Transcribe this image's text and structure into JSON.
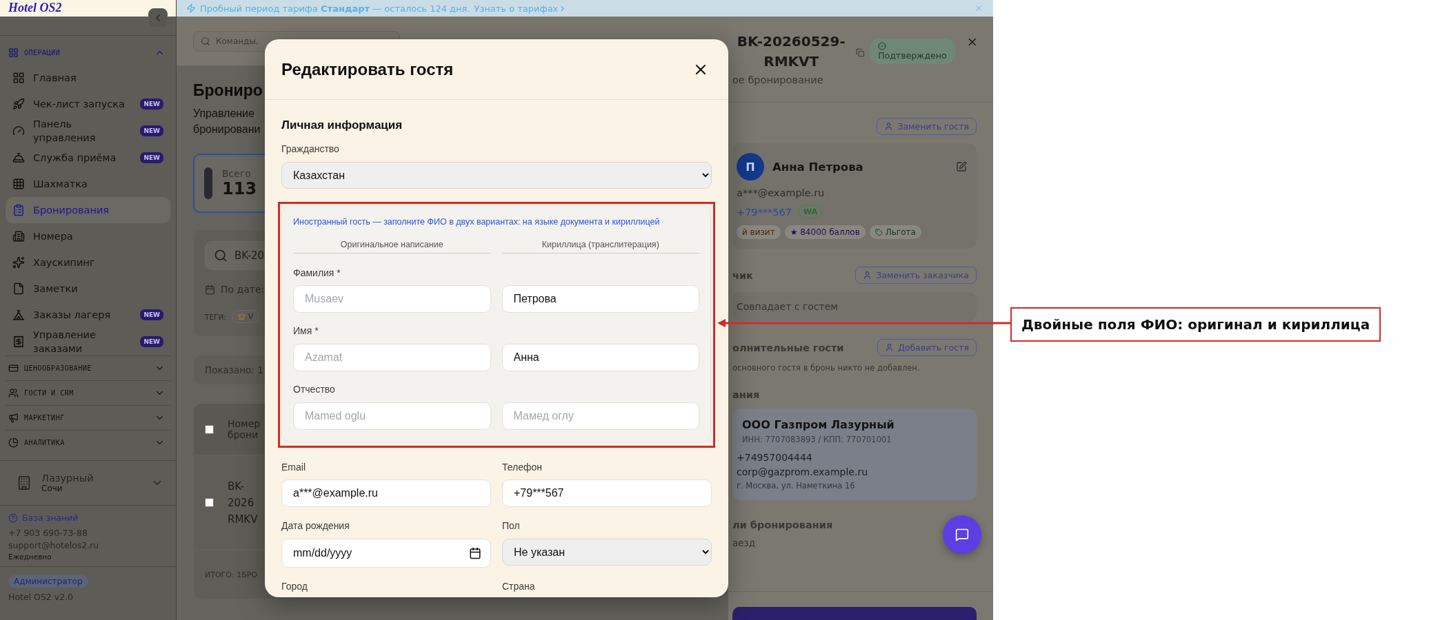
{
  "sidebar": {
    "logo": "Hotel OS2",
    "sections": [
      {
        "title": "ОПЕРАЦИИ",
        "expanded": true,
        "items": [
          {
            "label": "Главная",
            "selected": false
          },
          {
            "label": "Чек-лист запуска",
            "badge": "NEW",
            "selected": false
          },
          {
            "label": "Панель управления",
            "badge": "NEW",
            "selected": false
          },
          {
            "label": "Служба приёма",
            "badge": "NEW",
            "selected": false
          },
          {
            "label": "Шахматка",
            "selected": false
          },
          {
            "label": "Бронирования",
            "selected": true
          },
          {
            "label": "Номера",
            "selected": false
          },
          {
            "label": "Хаускипинг",
            "selected": false
          },
          {
            "label": "Заметки",
            "selected": false
          },
          {
            "label": "Заказы лагеря",
            "badge": "NEW",
            "selected": false
          },
          {
            "label": "Управление заказами",
            "badge": "NEW",
            "selected": false
          }
        ]
      },
      {
        "title": "ЦЕНООБРАЗОВАНИЕ",
        "expanded": false
      },
      {
        "title": "ГОСТИ И CRM",
        "expanded": false
      },
      {
        "title": "МАРКЕТИНГ",
        "expanded": false
      },
      {
        "title": "АНАЛИТИКА",
        "expanded": false
      }
    ],
    "hotel": {
      "name": "Лазурный",
      "city": "Сочи"
    },
    "help": {
      "link": "База знаний",
      "phone": "+7 903 690-73-88",
      "email": "support@hotelos2.ru",
      "hours": "Ежедневно"
    },
    "role": "Администратор",
    "version": "Hotel OS2 v2.0"
  },
  "banner": {
    "text": "Пробный период тарифа **Стандарт** — осталось 124 дня.",
    "link": "Узнать о тарифах"
  },
  "main": {
    "search_placeholder": "Команды,",
    "title": "Брониро",
    "subtitle": [
      "Управление",
      "бронировани"
    ],
    "stat": {
      "label": "Всего",
      "value": "113"
    },
    "filter": {
      "search_value": "BK-20",
      "date_label": "По дате:",
      "tags_label": "ТЕГИ:",
      "tag": "V"
    },
    "shown": "Показано: 1",
    "table": {
      "header_checked": false,
      "column": "Номер брони",
      "rows": [
        {
          "checked": false,
          "number": "BK-2026 RMKV"
        }
      ],
      "footer": "ИТОГО: 1БРО"
    }
  },
  "modal": {
    "title": "Редактировать гостя",
    "section": "Личная информация",
    "citizenship": {
      "label": "Гражданство",
      "value": "Казахстан"
    },
    "name_block": {
      "hint": "Иностранный гость — заполните ФИО в двух вариантах: на языке документа и кириллицей",
      "columns": [
        "Оригинальное написание",
        "Кириллица (транслитерация)"
      ],
      "rows": [
        {
          "label": "Фамилия *",
          "original": {
            "placeholder": "Musaev"
          },
          "cyrillic": {
            "value": "Петрова"
          }
        },
        {
          "label": "Имя *",
          "original": {
            "placeholder": "Azamat"
          },
          "cyrillic": {
            "value": "Анна"
          }
        },
        {
          "label": "Отчество",
          "original": {
            "placeholder": "Mamed oglu"
          },
          "cyrillic": {
            "placeholder": "Мамед оглу"
          }
        }
      ]
    },
    "fields": [
      {
        "label": "Email",
        "kind": "text",
        "value": "a***@example.ru"
      },
      {
        "label": "Телефон",
        "kind": "text",
        "value": "+79***567"
      },
      {
        "label": "Дата рождения",
        "kind": "date",
        "placeholder": "mm/dd/yyyy"
      },
      {
        "label": "Пол",
        "kind": "select",
        "value": "Не указан"
      },
      {
        "label": "Город"
      },
      {
        "label": "Страна"
      }
    ]
  },
  "drawer": {
    "title": "BK-20260529-RMKVT",
    "status": "Подтверждено",
    "subtitle": "ое бронирование",
    "guest_button": "Заменить гостя",
    "guest": {
      "avatar": "П",
      "name": "Анна Петрова",
      "email": "a***@example.ru",
      "phone": "+79***567",
      "messenger": "WA",
      "tags": [
        {
          "label": "й визит",
          "color": "#4a2a00"
        },
        {
          "label": "★ 84000 баллов",
          "color": "#220a66"
        },
        {
          "label": "Льгота",
          "color": "#053a2e"
        }
      ]
    },
    "customer": {
      "heading": "чик",
      "button": "Заменить заказчика",
      "note": "Совпадает с гостем"
    },
    "extra": {
      "heading": "олнительные гости",
      "button": "Добавить гостя",
      "note": "основного гостя в бронь никто не добавлен."
    },
    "company": {
      "heading": "ания",
      "name": "ООО Газпром Лазурный",
      "ids": "ИНН: 7707083893 / КПП: 770701001",
      "phone": "+74957004444",
      "email": "corp@gazprom.example.ru",
      "address": "г. Москва, ул. Наметкина 16"
    },
    "details": {
      "heading": "ли бронирования",
      "label": "аезд"
    }
  },
  "annotation": {
    "text": "Двойные поля ФИО: оригинал и кириллица"
  }
}
